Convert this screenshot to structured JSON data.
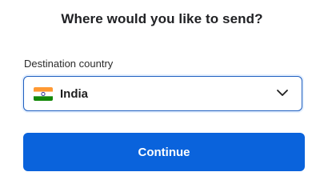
{
  "header": {
    "title": "Where would you like to send?"
  },
  "destination": {
    "label": "Destination country",
    "selected_value": "India",
    "flag_icon": "india-flag-icon",
    "chevron_icon": "chevron-down-icon"
  },
  "actions": {
    "continue_label": "Continue"
  },
  "colors": {
    "accent": "#0a63dc",
    "focus_border": "#1f5fbf",
    "flag_saffron": "#ff9933",
    "flag_white": "#ffffff",
    "flag_green": "#138808",
    "flag_chakra": "#000080"
  }
}
